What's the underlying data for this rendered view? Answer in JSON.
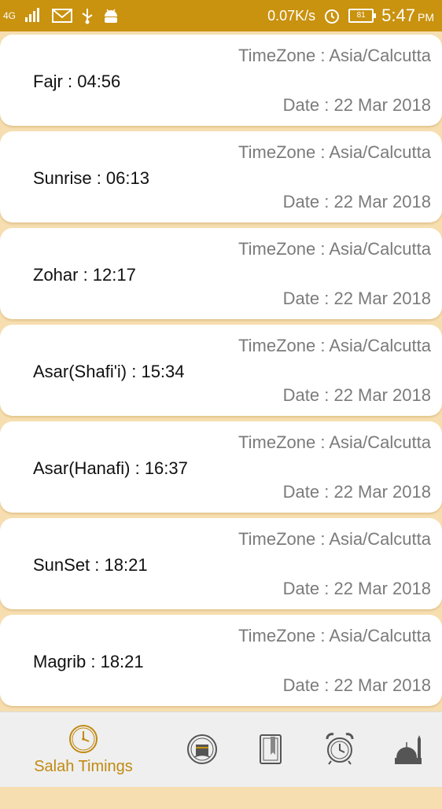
{
  "status_bar": {
    "network": "4G",
    "net_speed": "0.07K/s",
    "battery": "81",
    "time": "5:47",
    "ampm": "PM"
  },
  "cards": [
    {
      "prayer": "Fajr     : 04:56",
      "timezone": "TimeZone : Asia/Calcutta",
      "date": "Date  : 22 Mar 2018"
    },
    {
      "prayer": "Sunrise : 06:13",
      "timezone": "TimeZone : Asia/Calcutta",
      "date": "Date  : 22 Mar 2018"
    },
    {
      "prayer": "Zohar   : 12:17",
      "timezone": "TimeZone : Asia/Calcutta",
      "date": "Date  : 22 Mar 2018"
    },
    {
      "prayer": "Asar(Shafi'i)  : 15:34",
      "timezone": "TimeZone : Asia/Calcutta",
      "date": "Date  : 22 Mar 2018"
    },
    {
      "prayer": "Asar(Hanafi)  : 16:37",
      "timezone": "TimeZone : Asia/Calcutta",
      "date": "Date  : 22 Mar 2018"
    },
    {
      "prayer": "SunSet  : 18:21",
      "timezone": "TimeZone : Asia/Calcutta",
      "date": "Date  : 22 Mar 2018"
    },
    {
      "prayer": "Magrib  : 18:21",
      "timezone": "TimeZone : Asia/Calcutta",
      "date": "Date  : 22 Mar 2018"
    }
  ],
  "bottom_nav": {
    "active_label": "Salah Timings",
    "items": [
      {
        "icon": "clock-icon",
        "label": "Salah Timings",
        "active": true
      },
      {
        "icon": "kaaba-icon",
        "label": "",
        "active": false
      },
      {
        "icon": "book-icon",
        "label": "",
        "active": false
      },
      {
        "icon": "alarm-clock-icon",
        "label": "",
        "active": false
      },
      {
        "icon": "mosque-icon",
        "label": "",
        "active": false
      }
    ]
  },
  "colors": {
    "accent": "#c9920f",
    "background": "#f6deb0",
    "card": "#ffffff",
    "muted_text": "#7b7b7b"
  }
}
